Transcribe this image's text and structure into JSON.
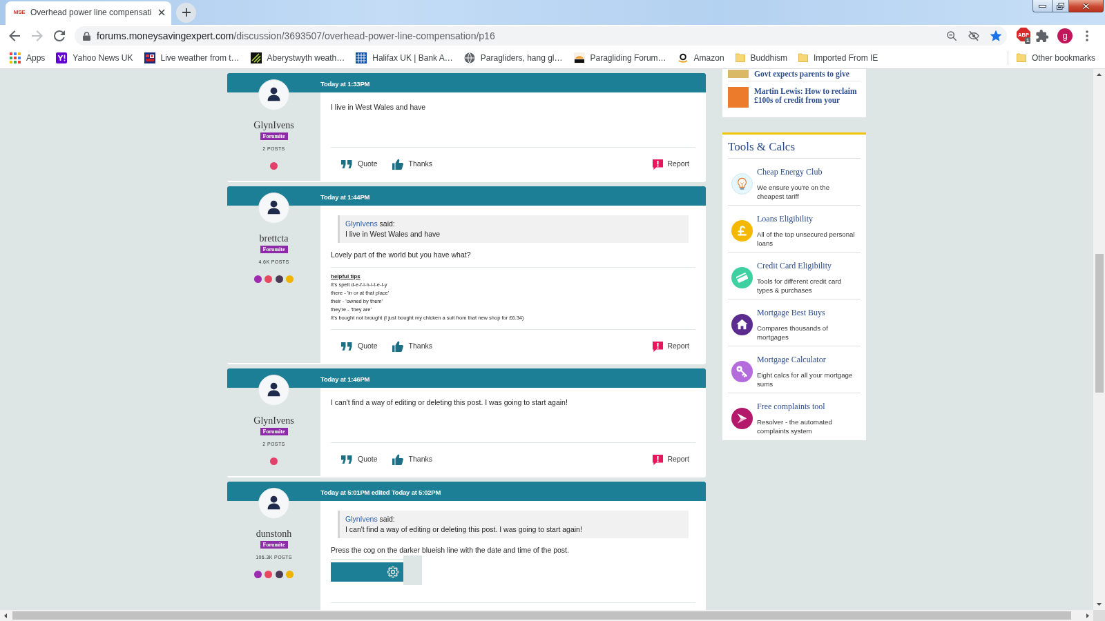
{
  "browser": {
    "tabs": [
      {
        "title": "Overhead power line compensati",
        "favicon_text": "MSE",
        "selected": true
      }
    ],
    "forward_disabled": true,
    "address": {
      "domain": "forums.moneysavingexpert.com",
      "path": "/discussion/3693507/overhead-power-line-compensation/p16"
    },
    "bookmarked": true,
    "extension": {
      "label": "ABP",
      "badge": "1"
    },
    "profile_initial": "g",
    "bookmarks": [
      {
        "kind": "apps",
        "label": "Apps"
      },
      {
        "kind": "site",
        "label": "Yahoo News UK"
      },
      {
        "kind": "site",
        "label": "Live weather from t…"
      },
      {
        "kind": "site",
        "label": "Aberystwyth weath…"
      },
      {
        "kind": "site",
        "label": "Halifax UK | Bank A…"
      },
      {
        "kind": "globe",
        "label": "Paragliders, hang gl…"
      },
      {
        "kind": "site",
        "label": "Paragliding Forum…"
      },
      {
        "kind": "site",
        "label": "Amazon"
      },
      {
        "kind": "folder",
        "label": "Buddhism"
      },
      {
        "kind": "folder",
        "label": "Imported From IE"
      }
    ],
    "other_bookmarks": {
      "kind": "folder",
      "label": "Other bookmarks"
    }
  },
  "posts": [
    {
      "time": "Today at 1:33PM",
      "author": "GlynIvens",
      "rank": "Forumite",
      "post_count": "2 POSTS",
      "badges": [
        {
          "color": "#e2416b"
        }
      ],
      "body": "I live in West Wales and have",
      "actions": [
        {
          "kind": "quote",
          "label": "Quote"
        },
        {
          "kind": "thanks",
          "label": "Thanks"
        },
        {
          "kind": "report",
          "label": "Report"
        }
      ]
    },
    {
      "time": "Today at 1:44PM",
      "author": "brettcta",
      "rank": "Forumite",
      "post_count": "4.6K POSTS",
      "badges": [
        {
          "color": "#9c2bb0"
        },
        {
          "color": "#e8485f"
        },
        {
          "color": "#4b3a55"
        },
        {
          "color": "#f0b400"
        }
      ],
      "quote": {
        "author": "GlynIvens",
        "suffix": "said:",
        "text": "I live in West Wales and have"
      },
      "body": "Lovely part of the world but you have what?",
      "signature": {
        "heading": "helpful tips",
        "lines": [
          "It's spelt d-e-f-i-n-i-t-e-l-y",
          "there - 'in or at that place'",
          "their - 'owned by them'",
          "they're - 'they are'",
          "It's bought not brought (I just bought my chicken a suit from that new shop for £6.34)"
        ]
      },
      "actions": [
        {
          "kind": "quote",
          "label": "Quote"
        },
        {
          "kind": "thanks",
          "label": "Thanks"
        },
        {
          "kind": "report",
          "label": "Report"
        }
      ]
    },
    {
      "time": "Today at 1:46PM",
      "author": "GlynIvens",
      "rank": "Forumite",
      "post_count": "2 POSTS",
      "badges": [
        {
          "color": "#e2416b"
        }
      ],
      "body": "I can't find a way of editing or deleting this post. I was going to start again!",
      "actions": [
        {
          "kind": "quote",
          "label": "Quote"
        },
        {
          "kind": "thanks",
          "label": "Thanks"
        },
        {
          "kind": "report",
          "label": "Report"
        }
      ]
    },
    {
      "time": "Today at 5:01PM edited Today at 5:02PM",
      "author": "dunstonh",
      "rank": "Forumite",
      "post_count": "106.3K POSTS",
      "badges": [
        {
          "color": "#9c2bb0"
        },
        {
          "color": "#e8485f"
        },
        {
          "color": "#4b3a55"
        },
        {
          "color": "#f0b400"
        }
      ],
      "quote": {
        "author": "GlynIvens",
        "suffix": "said:",
        "text": "I can't find a way of editing or deleting this post. I was going to start again!"
      },
      "body": "Press the cog on the darker blueish line with the date and time of the post.",
      "attachment": {
        "kind": "screenshot"
      }
    }
  ],
  "sidebar": {
    "articles": [
      {
        "title": "Govt expects parents to give"
      },
      {
        "title": "Martin Lewis: How to reclaim £100s of credit from your"
      }
    ],
    "tools": {
      "title": "Tools & Calcs",
      "items": [
        {
          "kind": "bulb",
          "title": "Cheap Energy Club",
          "description": "We ensure you're on the cheapest tariff"
        },
        {
          "kind": "pound",
          "title": "Loans Eligibility",
          "description": "All of the top unsecured personal loans"
        },
        {
          "kind": "card",
          "title": "Credit Card Eligibility",
          "description": "Tools for different credit card types & purchases"
        },
        {
          "kind": "house",
          "title": "Mortgage Best Buys",
          "description": "Compares thousands of mortgages"
        },
        {
          "kind": "key",
          "title": "Mortgage Calculator",
          "description": "Eight calcs for all your mortgage sums"
        },
        {
          "kind": "arrow",
          "title": "Free complaints tool",
          "description": "Resolver - the automated complaints system"
        }
      ]
    }
  }
}
